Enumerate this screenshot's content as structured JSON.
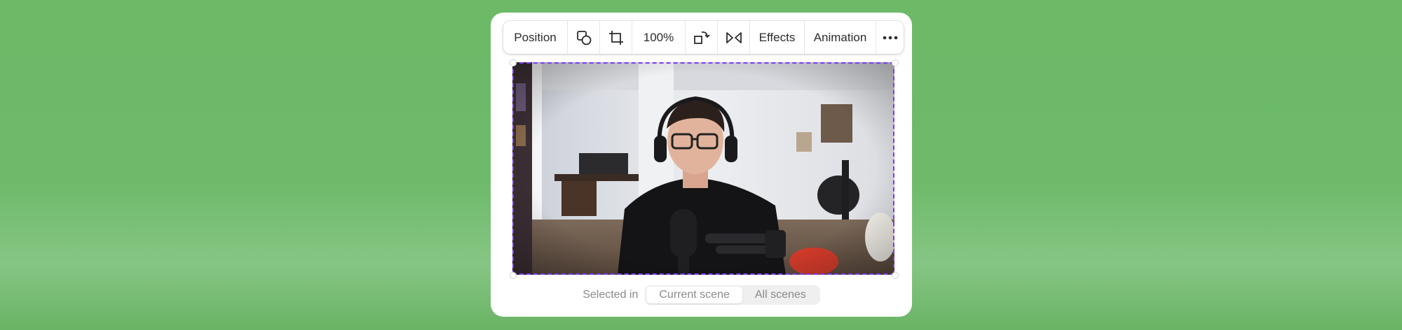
{
  "toolbar": {
    "position_label": "Position",
    "shape_icon": "shape-mask-icon",
    "crop_icon": "crop-icon",
    "zoom_value": "100%",
    "rotate_icon": "rotate-icon",
    "flip_icon": "flip-icon",
    "effects_label": "Effects",
    "animation_label": "Animation",
    "more_icon": "more-icon"
  },
  "canvas": {
    "content": "webcam-video-feed",
    "selection_color": "#7a3cf0"
  },
  "scope": {
    "label": "Selected in",
    "options": [
      "Current scene",
      "All scenes"
    ],
    "selected": "Current scene"
  },
  "colors": {
    "background": "#6cba68",
    "accent": "#7a3cf0"
  }
}
